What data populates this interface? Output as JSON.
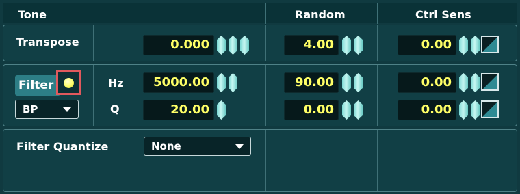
{
  "header": {
    "tone": "Tone",
    "random": "Random",
    "ctrl_sens": "Ctrl Sens"
  },
  "transpose": {
    "label": "Transpose",
    "value": "0.000",
    "random": "4.00",
    "ctrl_sens": "0.00"
  },
  "filter": {
    "button_label": "Filter",
    "type_select": "BP",
    "hz_label": "Hz",
    "hz_value": "5000.00",
    "hz_random": "90.00",
    "hz_ctrl_sens": "0.00",
    "q_label": "Q",
    "q_value": "20.00",
    "q_random": "0.00",
    "q_ctrl_sens": "0.00"
  },
  "filter_quantize": {
    "label": "Filter Quantize",
    "select": "None"
  },
  "colors": {
    "value_text": "#ffff66",
    "accent": "#2d7e86",
    "highlight_border": "#e0595d"
  }
}
